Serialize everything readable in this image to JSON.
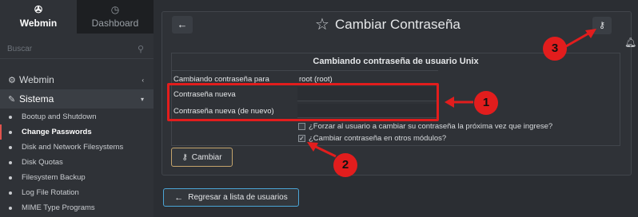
{
  "sidebar": {
    "tabs": [
      {
        "label": "Webmin",
        "icon": "gear-cogs-icon"
      },
      {
        "label": "Dashboard",
        "icon": "dashboard-gauge-icon"
      }
    ],
    "search_placeholder": "Buscar",
    "sections": [
      {
        "label": "Webmin",
        "icon": "gear-icon",
        "arrow": "‹"
      },
      {
        "label": "Sistema",
        "icon": "wrench-icon",
        "arrow": "▾"
      }
    ],
    "items": [
      "Bootup and Shutdown",
      "Change Passwords",
      "Disk and Network Filesystems",
      "Disk Quotas",
      "Filesystem Backup",
      "Log File Rotation",
      "MIME Type Programs"
    ],
    "active_item": "Change Passwords"
  },
  "header": {
    "title": "Cambiar Contraseña"
  },
  "form": {
    "heading": "Cambiando contraseña de usuario Unix",
    "rows": [
      {
        "label": "Cambiando contraseña para",
        "value": "root (root)"
      },
      {
        "label": "Contraseña nueva",
        "value": ""
      },
      {
        "label": "Contraseña nueva (de nuevo)",
        "value": ""
      }
    ],
    "checkboxes": [
      {
        "label": "¿Forzar al usuario a cambiar su contraseña la próxima vez que ingrese?",
        "checked": false
      },
      {
        "label": "¿Cambiar contraseña en otros módulos?",
        "checked": true
      }
    ],
    "submit_label": "Cambiar"
  },
  "back_link_label": "Regresar a lista de usuarios",
  "annotations": [
    "1",
    "2",
    "3"
  ],
  "colors": {
    "annotation_red": "#e21d1d",
    "submit_border": "#c4a46c",
    "back_border": "#4ba5d6",
    "active_marker": "#e0534d"
  }
}
